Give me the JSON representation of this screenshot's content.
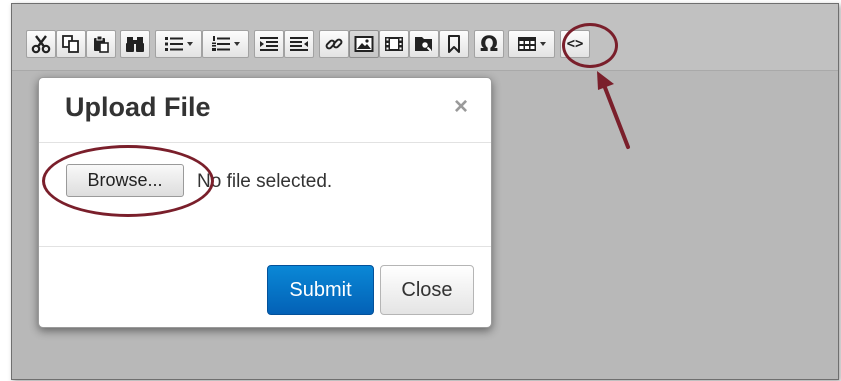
{
  "toolbar": {
    "buttons": [
      {
        "icon": "cut-icon",
        "dropdown": false
      },
      {
        "icon": "copy-icon",
        "dropdown": false
      },
      {
        "icon": "paste-icon",
        "dropdown": false
      },
      {
        "icon": "find-icon",
        "dropdown": false
      },
      {
        "icon": "bulleted-list-icon",
        "dropdown": true
      },
      {
        "icon": "numbered-list-icon",
        "dropdown": true
      },
      {
        "icon": "indent-icon",
        "dropdown": false
      },
      {
        "icon": "outdent-icon",
        "dropdown": false
      },
      {
        "icon": "link-icon",
        "dropdown": false
      },
      {
        "icon": "image-icon",
        "dropdown": false,
        "active": true
      },
      {
        "icon": "video-icon",
        "dropdown": false
      },
      {
        "icon": "file-search-icon",
        "dropdown": false,
        "highlighted": true
      },
      {
        "icon": "bookmark-icon",
        "dropdown": false
      },
      {
        "icon": "omega-icon",
        "label": "Ω",
        "dropdown": false
      },
      {
        "icon": "table-icon",
        "dropdown": true
      },
      {
        "icon": "source-code-icon",
        "label": "<>",
        "dropdown": false
      }
    ]
  },
  "dialog": {
    "title": "Upload File",
    "close_glyph": "×",
    "browse_label": "Browse...",
    "no_file_text": "No file selected.",
    "submit_label": "Submit",
    "close_label": "Close"
  },
  "colors": {
    "annotation": "#7a1f2b",
    "primary_button": "#0766c0",
    "editor_background": "#b8b8b8"
  }
}
